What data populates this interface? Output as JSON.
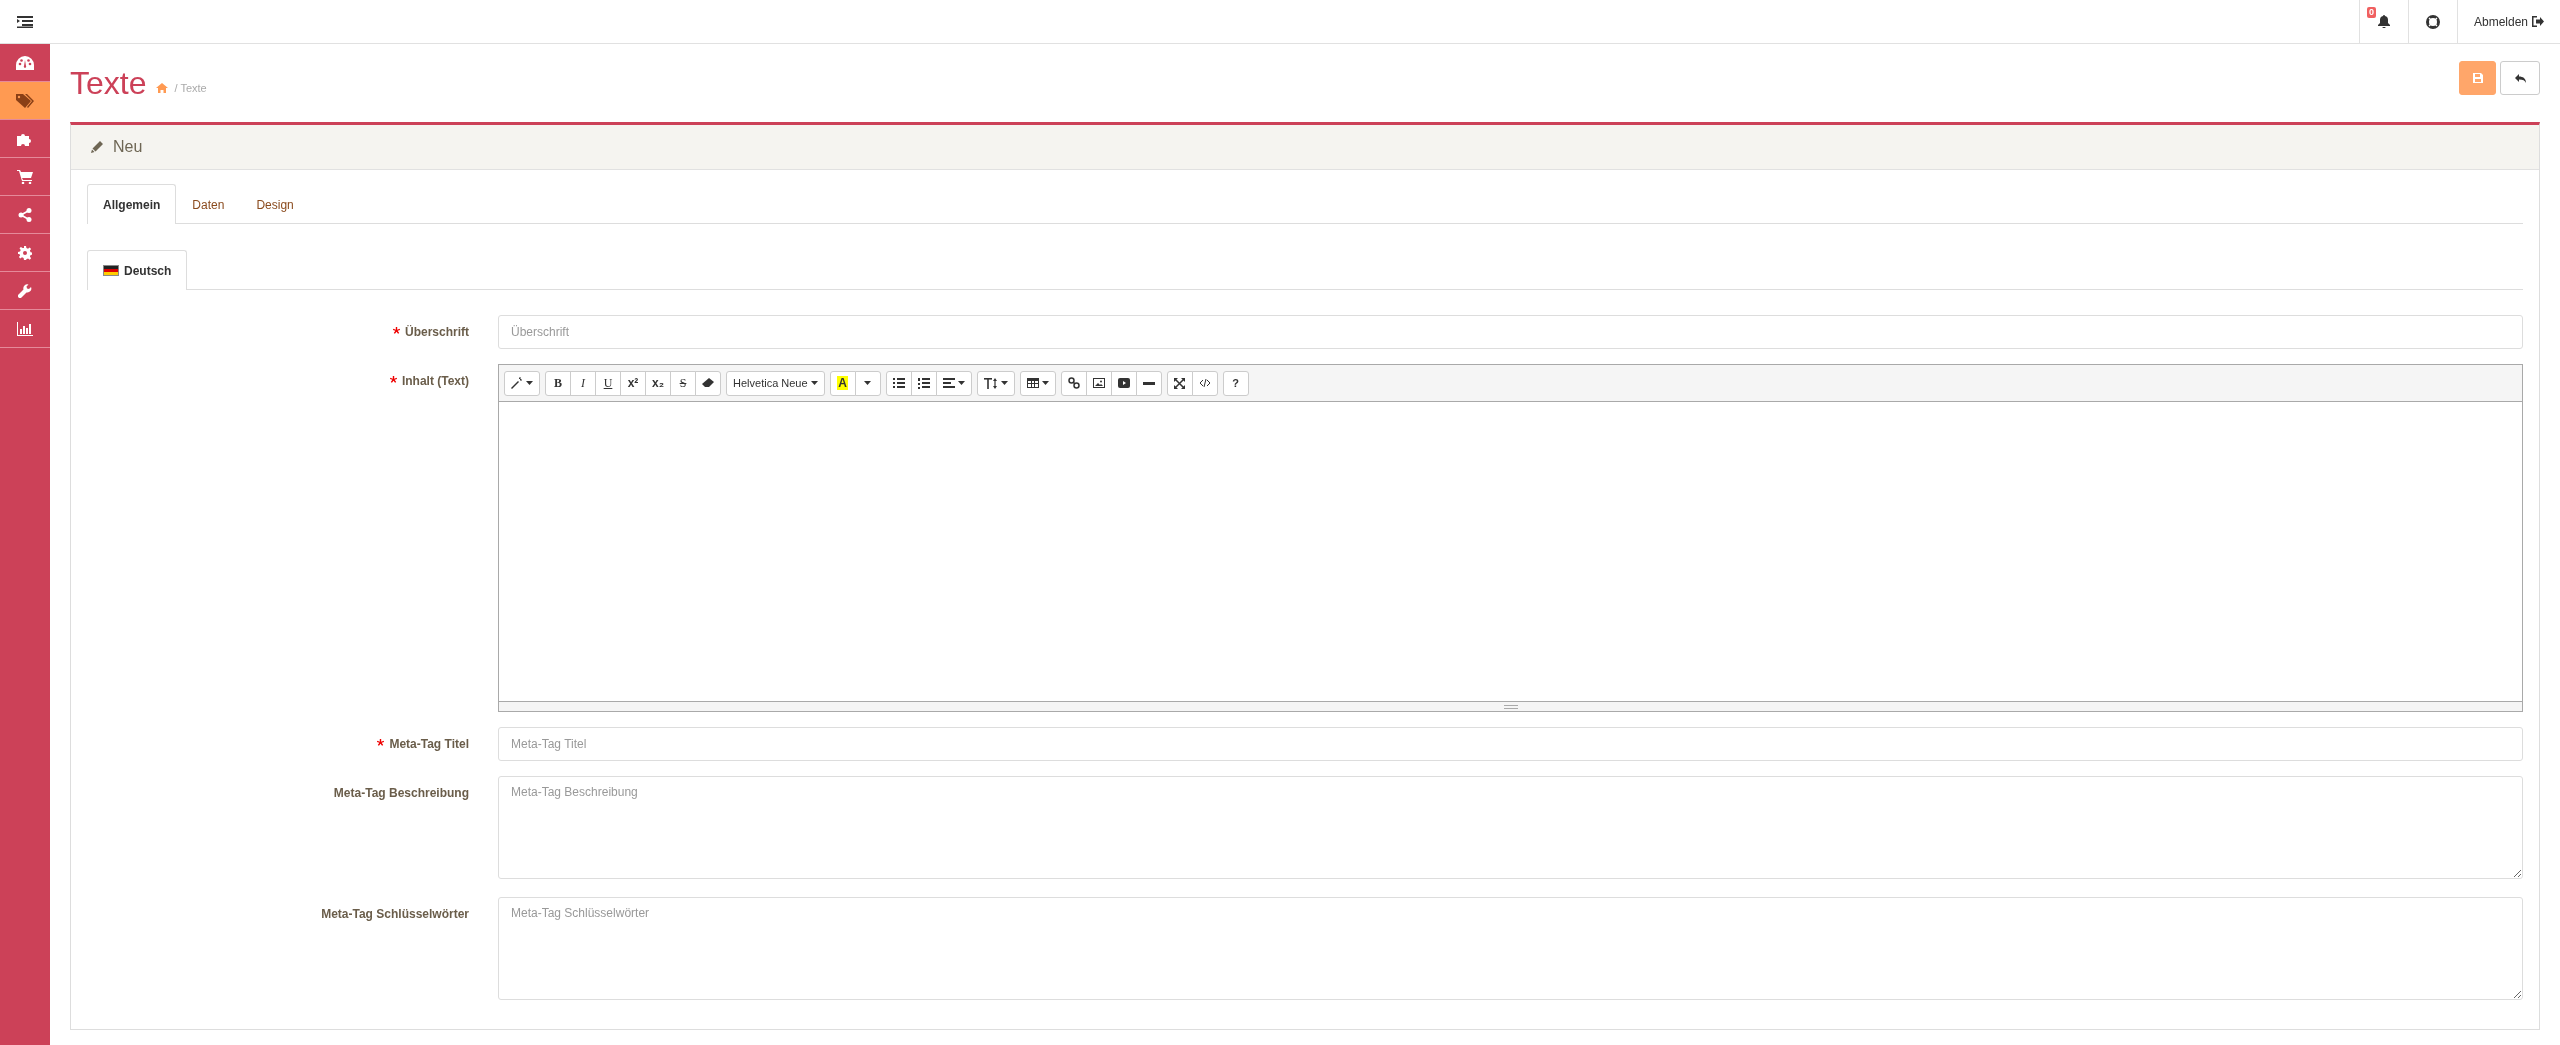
{
  "sidebar": {
    "items": [
      {
        "selected": false
      },
      {
        "selected": true
      },
      {
        "selected": false
      },
      {
        "selected": false
      },
      {
        "selected": false
      },
      {
        "selected": false
      },
      {
        "selected": false
      },
      {
        "selected": false
      }
    ]
  },
  "header": {
    "notification_count": "0",
    "logout": "Abmelden"
  },
  "page": {
    "title": "Texte",
    "breadcrumb": "/ Texte"
  },
  "panel": {
    "title": "Neu"
  },
  "tabs": [
    {
      "label": "Allgemein",
      "selected": true
    },
    {
      "label": "Daten",
      "selected": false
    },
    {
      "label": "Design",
      "selected": false
    }
  ],
  "languages": [
    {
      "label": "Deutsch",
      "selected": true
    }
  ],
  "editor": {
    "format_buttons": [
      "B",
      "I",
      "U",
      "x²",
      "x₂",
      "S"
    ],
    "font": "Helvetica Neue",
    "color_button": "A",
    "help": "?"
  },
  "fields": [
    {
      "kind": "input",
      "label": "Überschrift",
      "required": true,
      "placeholder": "Überschrift"
    },
    {
      "kind": "editor",
      "label": "Inhalt (Text)",
      "required": true
    },
    {
      "kind": "input",
      "label": "Meta-Tag Titel",
      "required": true,
      "placeholder": "Meta-Tag Titel"
    },
    {
      "kind": "textarea",
      "label": "Meta-Tag Beschreibung",
      "required": false,
      "placeholder": "Meta-Tag Beschreibung"
    },
    {
      "kind": "textarea",
      "label": "Meta-Tag Schlüsselwörter",
      "required": false,
      "placeholder": "Meta-Tag Schlüsselwörter"
    }
  ]
}
